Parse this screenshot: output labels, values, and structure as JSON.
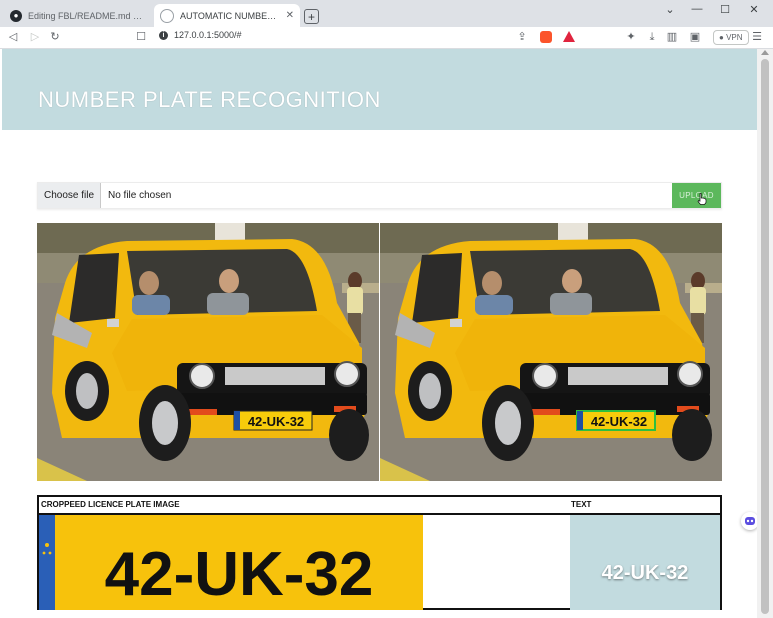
{
  "browser": {
    "tabs": [
      {
        "title": "Editing FBL/README.md at main · ...",
        "active": false
      },
      {
        "title": "AUTOMATIC NUMBER-PLATE REC",
        "active": true
      }
    ],
    "url": "127.0.0.1:5000/#",
    "vpn_label": "VPN",
    "window_controls": [
      "⌄",
      "—",
      "☐",
      "✕"
    ]
  },
  "page": {
    "hero_title": "NUMBER PLATE RECOGNITION",
    "upload": {
      "choose_label": "Choose file",
      "file_status": "No file chosen",
      "button_label": "UPLOAD"
    },
    "images": {
      "original_plate": "42-UK-32",
      "detected_plate": "42-UK-32"
    },
    "table": {
      "col1_header": "CROPPEED LICENCE PLATE IMAGE",
      "col2_header": "TEXT",
      "crop_plate_text": "42-UK-32",
      "result_text": "42-UK-32"
    }
  },
  "colors": {
    "hero_bg": "#c2dbdf",
    "upload_button": "#5cb85c",
    "car_yellow": "#f2b90e",
    "plate_yellow": "#f7cc0b"
  }
}
